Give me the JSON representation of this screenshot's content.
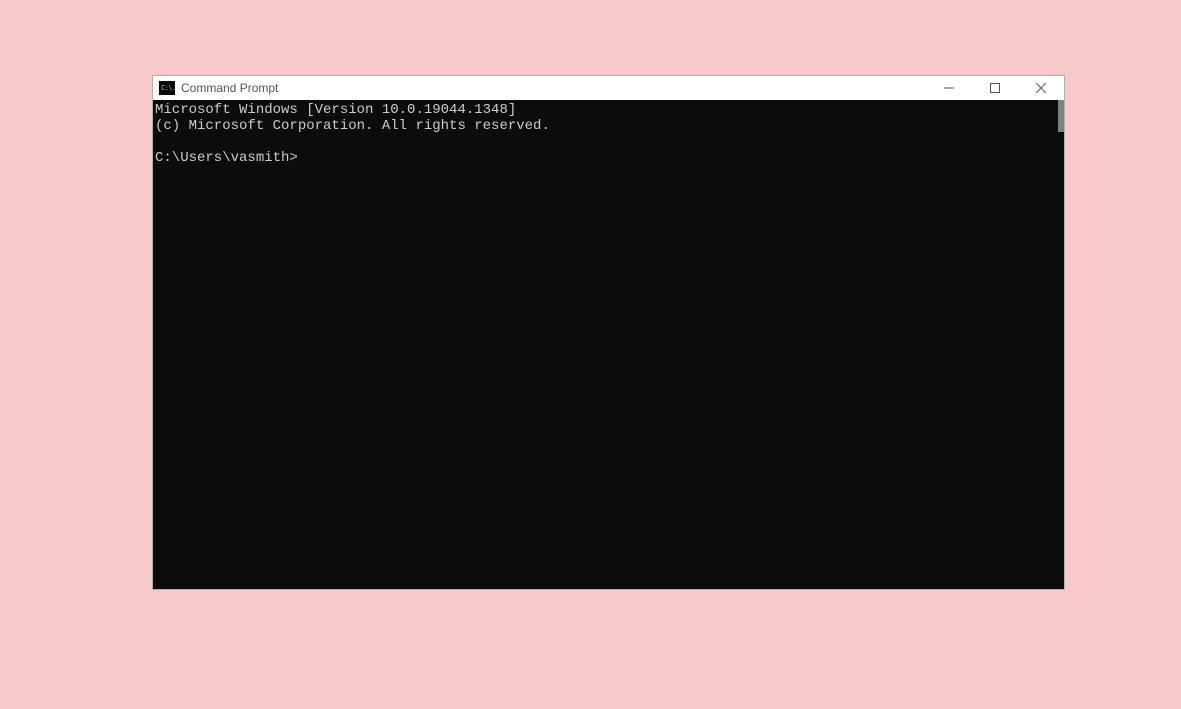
{
  "window": {
    "title": "Command Prompt",
    "icon_text": "C:\\."
  },
  "console": {
    "line1": "Microsoft Windows [Version 10.0.19044.1348]",
    "line2": "(c) Microsoft Corporation. All rights reserved.",
    "blank": "",
    "prompt": "C:\\Users\\vasmith>"
  }
}
